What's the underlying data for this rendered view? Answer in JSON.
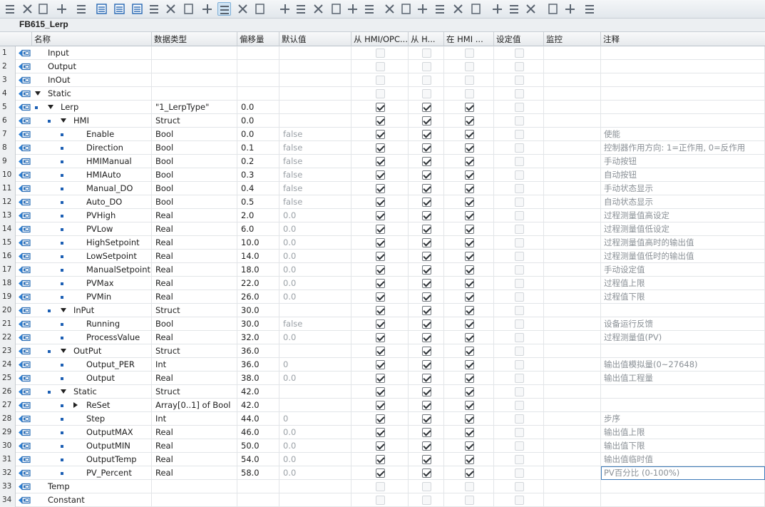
{
  "toolbar": {
    "icons": [
      "insert-row-icon",
      "delete-row-icon",
      "insert-var-icon",
      "add-var-icon",
      "monitor-icon",
      "expand-all-icon",
      "collapse-all-icon",
      "show-hide-icon",
      "comment-icon",
      "update-interface-icon",
      "compile-icon",
      "instance-icon",
      "retain-icon",
      "list-icon",
      "settings-icon",
      "navigate-icon",
      "indent-icon",
      "outdent-icon",
      "toggle-icon",
      "bookmark-icon",
      "prev-bookmark-icon",
      "next-bookmark-icon",
      "glasses-icon",
      "watch-table-icon",
      "snapshot-icon"
    ]
  },
  "block": {
    "title": "FB615_Lerp"
  },
  "columns": {
    "name": "名称",
    "datatype": "数据类型",
    "offset": "偏移量",
    "default": "默认值",
    "hmi_opc": "从 HMI/OPC...",
    "hmi_h": "从 H...",
    "in_hmi": "在 HMI ...",
    "setpoint": "设定值",
    "monitor": "监控",
    "comment": "注释"
  },
  "rows": [
    {
      "n": "1",
      "name": "Input",
      "level": 0,
      "exp": "",
      "dtype": "",
      "offset": "",
      "def": "",
      "c": [
        0,
        0,
        0,
        0
      ],
      "comment": ""
    },
    {
      "n": "2",
      "name": "Output",
      "level": 0,
      "exp": "",
      "dtype": "",
      "offset": "",
      "def": "",
      "c": [
        0,
        0,
        0,
        0
      ],
      "comment": ""
    },
    {
      "n": "3",
      "name": "InOut",
      "level": 0,
      "exp": "",
      "dtype": "",
      "offset": "",
      "def": "",
      "c": [
        0,
        0,
        0,
        0
      ],
      "comment": ""
    },
    {
      "n": "4",
      "name": "Static",
      "level": 0,
      "exp": "down",
      "dtype": "",
      "offset": "",
      "def": "",
      "c": [
        0,
        0,
        0,
        0
      ],
      "comment": ""
    },
    {
      "n": "5",
      "name": "Lerp",
      "level": 1,
      "exp": "down",
      "dtype": "\"1_LerpType\"",
      "offset": "0.0",
      "def": "",
      "c": [
        1,
        1,
        1,
        0
      ],
      "comment": ""
    },
    {
      "n": "6",
      "name": "HMI",
      "level": 2,
      "exp": "down",
      "dtype": "Struct",
      "offset": "0.0",
      "def": "",
      "c": [
        1,
        1,
        1,
        0
      ],
      "comment": ""
    },
    {
      "n": "7",
      "name": "Enable",
      "level": 3,
      "exp": "",
      "dtype": "Bool",
      "offset": "0.0",
      "def": "false",
      "c": [
        1,
        1,
        1,
        0
      ],
      "comment": "使能"
    },
    {
      "n": "8",
      "name": "Direction",
      "level": 3,
      "exp": "",
      "dtype": "Bool",
      "offset": "0.1",
      "def": "false",
      "c": [
        1,
        1,
        1,
        0
      ],
      "comment": "控制器作用方向: 1=正作用, 0=反作用"
    },
    {
      "n": "9",
      "name": "HMIManual",
      "level": 3,
      "exp": "",
      "dtype": "Bool",
      "offset": "0.2",
      "def": "false",
      "c": [
        1,
        1,
        1,
        0
      ],
      "comment": "手动按钮"
    },
    {
      "n": "10",
      "name": "HMIAuto",
      "level": 3,
      "exp": "",
      "dtype": "Bool",
      "offset": "0.3",
      "def": "false",
      "c": [
        1,
        1,
        1,
        0
      ],
      "comment": "自动按钮"
    },
    {
      "n": "11",
      "name": "Manual_DO",
      "level": 3,
      "exp": "",
      "dtype": "Bool",
      "offset": "0.4",
      "def": "false",
      "c": [
        1,
        1,
        1,
        0
      ],
      "comment": "手动状态显示"
    },
    {
      "n": "12",
      "name": "Auto_DO",
      "level": 3,
      "exp": "",
      "dtype": "Bool",
      "offset": "0.5",
      "def": "false",
      "c": [
        1,
        1,
        1,
        0
      ],
      "comment": "自动状态显示"
    },
    {
      "n": "13",
      "name": "PVHigh",
      "level": 3,
      "exp": "",
      "dtype": "Real",
      "offset": "2.0",
      "def": "0.0",
      "c": [
        1,
        1,
        1,
        0
      ],
      "comment": "过程测量值高设定"
    },
    {
      "n": "14",
      "name": "PVLow",
      "level": 3,
      "exp": "",
      "dtype": "Real",
      "offset": "6.0",
      "def": "0.0",
      "c": [
        1,
        1,
        1,
        0
      ],
      "comment": "过程测量值低设定"
    },
    {
      "n": "15",
      "name": "HighSetpoint",
      "level": 3,
      "exp": "",
      "dtype": "Real",
      "offset": "10.0",
      "def": "0.0",
      "c": [
        1,
        1,
        1,
        0
      ],
      "comment": "过程测量值高时的输出值"
    },
    {
      "n": "16",
      "name": "LowSetpoint",
      "level": 3,
      "exp": "",
      "dtype": "Real",
      "offset": "14.0",
      "def": "0.0",
      "c": [
        1,
        1,
        1,
        0
      ],
      "comment": "过程测量值低时的输出值"
    },
    {
      "n": "17",
      "name": "ManualSetpoint",
      "level": 3,
      "exp": "",
      "dtype": "Real",
      "offset": "18.0",
      "def": "0.0",
      "c": [
        1,
        1,
        1,
        0
      ],
      "comment": "手动设定值"
    },
    {
      "n": "18",
      "name": "PVMax",
      "level": 3,
      "exp": "",
      "dtype": "Real",
      "offset": "22.0",
      "def": "0.0",
      "c": [
        1,
        1,
        1,
        0
      ],
      "comment": "过程值上限"
    },
    {
      "n": "19",
      "name": "PVMin",
      "level": 3,
      "exp": "",
      "dtype": "Real",
      "offset": "26.0",
      "def": "0.0",
      "c": [
        1,
        1,
        1,
        0
      ],
      "comment": "过程值下限"
    },
    {
      "n": "20",
      "name": "InPut",
      "level": 2,
      "exp": "down",
      "dtype": "Struct",
      "offset": "30.0",
      "def": "",
      "c": [
        1,
        1,
        1,
        0
      ],
      "comment": ""
    },
    {
      "n": "21",
      "name": "Running",
      "level": 3,
      "exp": "",
      "dtype": "Bool",
      "offset": "30.0",
      "def": "false",
      "c": [
        1,
        1,
        1,
        0
      ],
      "comment": "设备运行反馈"
    },
    {
      "n": "22",
      "name": "ProcessValue",
      "level": 3,
      "exp": "",
      "dtype": "Real",
      "offset": "32.0",
      "def": "0.0",
      "c": [
        1,
        1,
        1,
        0
      ],
      "comment": "过程测量值(PV)"
    },
    {
      "n": "23",
      "name": "OutPut",
      "level": 2,
      "exp": "down",
      "dtype": "Struct",
      "offset": "36.0",
      "def": "",
      "c": [
        1,
        1,
        1,
        0
      ],
      "comment": ""
    },
    {
      "n": "24",
      "name": "Output_PER",
      "level": 3,
      "exp": "",
      "dtype": "Int",
      "offset": "36.0",
      "def": "0",
      "c": [
        1,
        1,
        1,
        0
      ],
      "comment": "输出值模拟量(0~27648)"
    },
    {
      "n": "25",
      "name": "Output",
      "level": 3,
      "exp": "",
      "dtype": "Real",
      "offset": "38.0",
      "def": "0.0",
      "c": [
        1,
        1,
        1,
        0
      ],
      "comment": "输出值工程量"
    },
    {
      "n": "26",
      "name": "Static",
      "level": 2,
      "exp": "down",
      "dtype": "Struct",
      "offset": "42.0",
      "def": "",
      "c": [
        1,
        1,
        1,
        0
      ],
      "comment": ""
    },
    {
      "n": "27",
      "name": "ReSet",
      "level": 3,
      "exp": "right",
      "dtype": "Array[0..1] of Bool",
      "offset": "42.0",
      "def": "",
      "c": [
        1,
        1,
        1,
        0
      ],
      "comment": ""
    },
    {
      "n": "28",
      "name": "Step",
      "level": 3,
      "exp": "",
      "dtype": "Int",
      "offset": "44.0",
      "def": "0",
      "c": [
        1,
        1,
        1,
        0
      ],
      "comment": "步序"
    },
    {
      "n": "29",
      "name": "OutputMAX",
      "level": 3,
      "exp": "",
      "dtype": "Real",
      "offset": "46.0",
      "def": "0.0",
      "c": [
        1,
        1,
        1,
        0
      ],
      "comment": "输出值上限"
    },
    {
      "n": "30",
      "name": "OutputMIN",
      "level": 3,
      "exp": "",
      "dtype": "Real",
      "offset": "50.0",
      "def": "0.0",
      "c": [
        1,
        1,
        1,
        0
      ],
      "comment": "输出值下限"
    },
    {
      "n": "31",
      "name": "OutputTemp",
      "level": 3,
      "exp": "",
      "dtype": "Real",
      "offset": "54.0",
      "def": "0.0",
      "c": [
        1,
        1,
        1,
        0
      ],
      "comment": "输出值临时值"
    },
    {
      "n": "32",
      "name": "PV_Percent",
      "level": 3,
      "exp": "",
      "dtype": "Real",
      "offset": "58.0",
      "def": "0.0",
      "c": [
        1,
        1,
        1,
        0
      ],
      "comment": "PV百分比 (0-100%)",
      "selected": true
    },
    {
      "n": "33",
      "name": "Temp",
      "level": 0,
      "exp": "",
      "dtype": "",
      "offset": "",
      "def": "",
      "c": [
        0,
        0,
        0,
        0
      ],
      "comment": ""
    },
    {
      "n": "34",
      "name": "Constant",
      "level": 0,
      "exp": "",
      "dtype": "",
      "offset": "",
      "def": "",
      "c": [
        0,
        0,
        0,
        0
      ],
      "comment": ""
    }
  ]
}
